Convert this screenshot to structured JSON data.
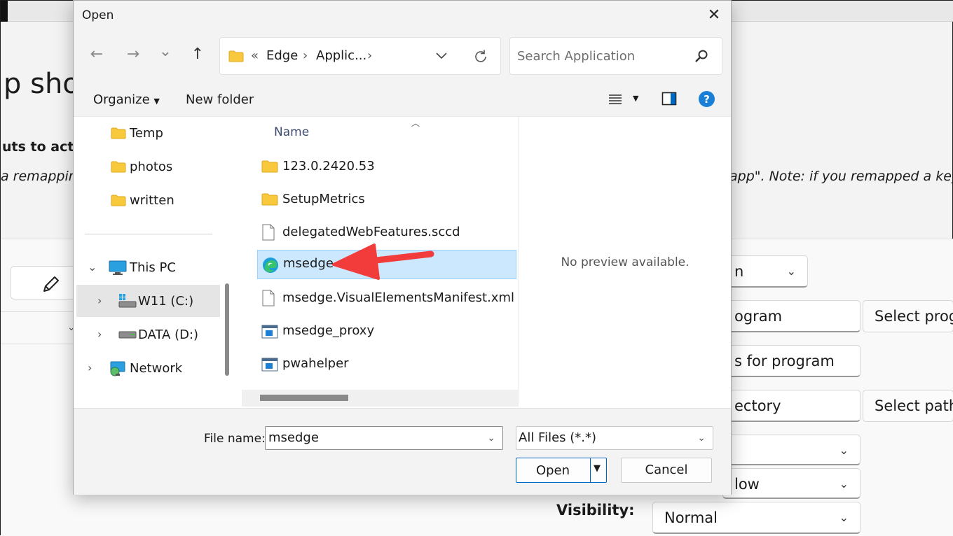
{
  "background": {
    "title_fragment": "p sho",
    "bold_fragment": "uts to activa",
    "italic_left": "a remapping",
    "italic_right": "app\". Note: if you remapped a key,",
    "fields": {
      "app_combo": "n",
      "program_field": "ogram",
      "select_program_button": "Select progr",
      "args_field": "s for program",
      "dir_field": "ectory",
      "select_path_button": "Select path",
      "combo_a": "",
      "combo_b": "low",
      "visibility_label": "Visibility:",
      "visibility_value": "Normal"
    }
  },
  "dialog": {
    "title": "Open",
    "nav": {
      "back": "←",
      "forward": "→",
      "recent": "⌄",
      "up": "↑"
    },
    "address": {
      "overflow": "«",
      "segments": [
        "Edge",
        "Applic..."
      ],
      "separator": "›"
    },
    "search_placeholder": "Search Application",
    "toolbar": {
      "organize": "Organize",
      "new_folder": "New folder"
    },
    "nav_tree": [
      {
        "label": "Temp"
      },
      {
        "label": "photos"
      },
      {
        "label": "written"
      },
      {
        "label": "This PC"
      },
      {
        "label": "W11 (C:)"
      },
      {
        "label": "DATA (D:)"
      },
      {
        "label": "Network"
      }
    ],
    "column_header": "Name",
    "files": [
      {
        "name": "123.0.2420.53",
        "kind": "folder"
      },
      {
        "name": "SetupMetrics",
        "kind": "folder"
      },
      {
        "name": "delegatedWebFeatures.sccd",
        "kind": "file"
      },
      {
        "name": "msedge",
        "kind": "edge"
      },
      {
        "name": "msedge.VisualElementsManifest.xml",
        "kind": "file"
      },
      {
        "name": "msedge_proxy",
        "kind": "exe"
      },
      {
        "name": "pwahelper",
        "kind": "exe"
      }
    ],
    "preview_message": "No preview available.",
    "file_name_label": "File name:",
    "file_name_value": "msedge",
    "file_type": "All Files (*.*)",
    "open_button": "Open",
    "cancel_button": "Cancel"
  },
  "colors": {
    "accent": "#0067c0",
    "selection": "#cce8ff",
    "folder": "#f8c93c",
    "annotation_arrow": "#f23c3c",
    "help": "#1a7fd6"
  }
}
